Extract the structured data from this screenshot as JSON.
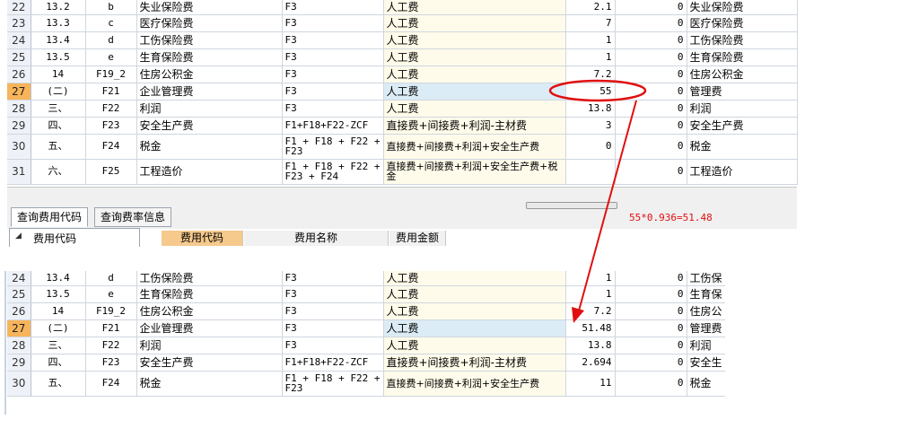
{
  "top_table": {
    "rows": [
      {
        "rn": "22",
        "code": "13.2",
        "sym": "b",
        "name": "失业保险费",
        "base": "F3",
        "desc": "人工费",
        "rate": "2.1",
        "amount": "0",
        "remark": "失业保险费"
      },
      {
        "rn": "23",
        "code": "13.3",
        "sym": "c",
        "name": "医疗保险费",
        "base": "F3",
        "desc": "人工费",
        "rate": "7",
        "amount": "0",
        "remark": "医疗保险费"
      },
      {
        "rn": "24",
        "code": "13.4",
        "sym": "d",
        "name": "工伤保险费",
        "base": "F3",
        "desc": "人工费",
        "rate": "1",
        "amount": "0",
        "remark": "工伤保险费"
      },
      {
        "rn": "25",
        "code": "13.5",
        "sym": "e",
        "name": "生育保险费",
        "base": "F3",
        "desc": "人工费",
        "rate": "1",
        "amount": "0",
        "remark": "生育保险费"
      },
      {
        "rn": "26",
        "code": "14",
        "sym": "F19_2",
        "name": "住房公积金",
        "base": "F3",
        "desc": "人工费",
        "rate": "7.2",
        "amount": "0",
        "remark": "住房公积金"
      },
      {
        "rn": "27",
        "code": "(二)",
        "sym": "F21",
        "name": "企业管理费",
        "base": "F3",
        "desc": "人工费",
        "rate": "55",
        "amount": "0",
        "remark": "管理费"
      },
      {
        "rn": "28",
        "code": "三、",
        "sym": "F22",
        "name": "利润",
        "base": "F3",
        "desc": "人工费",
        "rate": "13.8",
        "amount": "0",
        "remark": "利润"
      },
      {
        "rn": "29",
        "code": "四、",
        "sym": "F23",
        "name": "安全生产费",
        "base": "F1+F18+F22-ZCF",
        "desc": "直接费+间接费+利润-主材费",
        "rate": "3",
        "amount": "0",
        "remark": "安全生产费"
      },
      {
        "rn": "30",
        "code": "五、",
        "sym": "F24",
        "name": "税金",
        "base": "F1 + F18 + F22 + F23",
        "desc": "直接费+间接费+利润+安全生产费",
        "rate": "0",
        "amount": "0",
        "remark": "税金"
      },
      {
        "rn": "31",
        "code": "六、",
        "sym": "F25",
        "name": "工程造价",
        "base": "F1 + F18 + F22 + F23 + F24",
        "desc": "直接费+间接费+利润+安全生产费+税金",
        "rate": "",
        "amount": "0",
        "remark": "工程造价"
      }
    ]
  },
  "tabs": [
    {
      "label": "查询费用代码"
    },
    {
      "label": "查询费率信息"
    }
  ],
  "tree": {
    "label": "费用代码"
  },
  "columns": [
    {
      "label": "费用代码"
    },
    {
      "label": "费用名称"
    },
    {
      "label": "费用金额"
    }
  ],
  "annotation": {
    "formula": "55*0.936=51.48",
    "color": "#e01010"
  },
  "bottom_table": {
    "rows": [
      {
        "rn": "24",
        "code": "13.4",
        "sym": "d",
        "name": "工伤保险费",
        "base": "F3",
        "desc": "人工费",
        "rate": "1",
        "amount": "0",
        "remark": "工伤保"
      },
      {
        "rn": "25",
        "code": "13.5",
        "sym": "e",
        "name": "生育保险费",
        "base": "F3",
        "desc": "人工费",
        "rate": "1",
        "amount": "0",
        "remark": "生育保"
      },
      {
        "rn": "26",
        "code": "14",
        "sym": "F19_2",
        "name": "住房公积金",
        "base": "F3",
        "desc": "人工费",
        "rate": "7.2",
        "amount": "0",
        "remark": "住房公"
      },
      {
        "rn": "27",
        "code": "(二)",
        "sym": "F21",
        "name": "企业管理费",
        "base": "F3",
        "desc": "人工费",
        "rate": "51.48",
        "amount": "0",
        "remark": "管理费"
      },
      {
        "rn": "28",
        "code": "三、",
        "sym": "F22",
        "name": "利润",
        "base": "F3",
        "desc": "人工费",
        "rate": "13.8",
        "amount": "0",
        "remark": "利润"
      },
      {
        "rn": "29",
        "code": "四、",
        "sym": "F23",
        "name": "安全生产费",
        "base": "F1+F18+F22-ZCF",
        "desc": "直接费+间接费+利润-主材费",
        "rate": "2.694",
        "amount": "0",
        "remark": "安全生"
      },
      {
        "rn": "30",
        "code": "五、",
        "sym": "F24",
        "name": "税金",
        "base": "F1 + F18 + F22 + F23",
        "desc": "直接费+间接费+利润+安全生产费",
        "rate": "11",
        "amount": "0",
        "remark": "税金"
      }
    ]
  }
}
